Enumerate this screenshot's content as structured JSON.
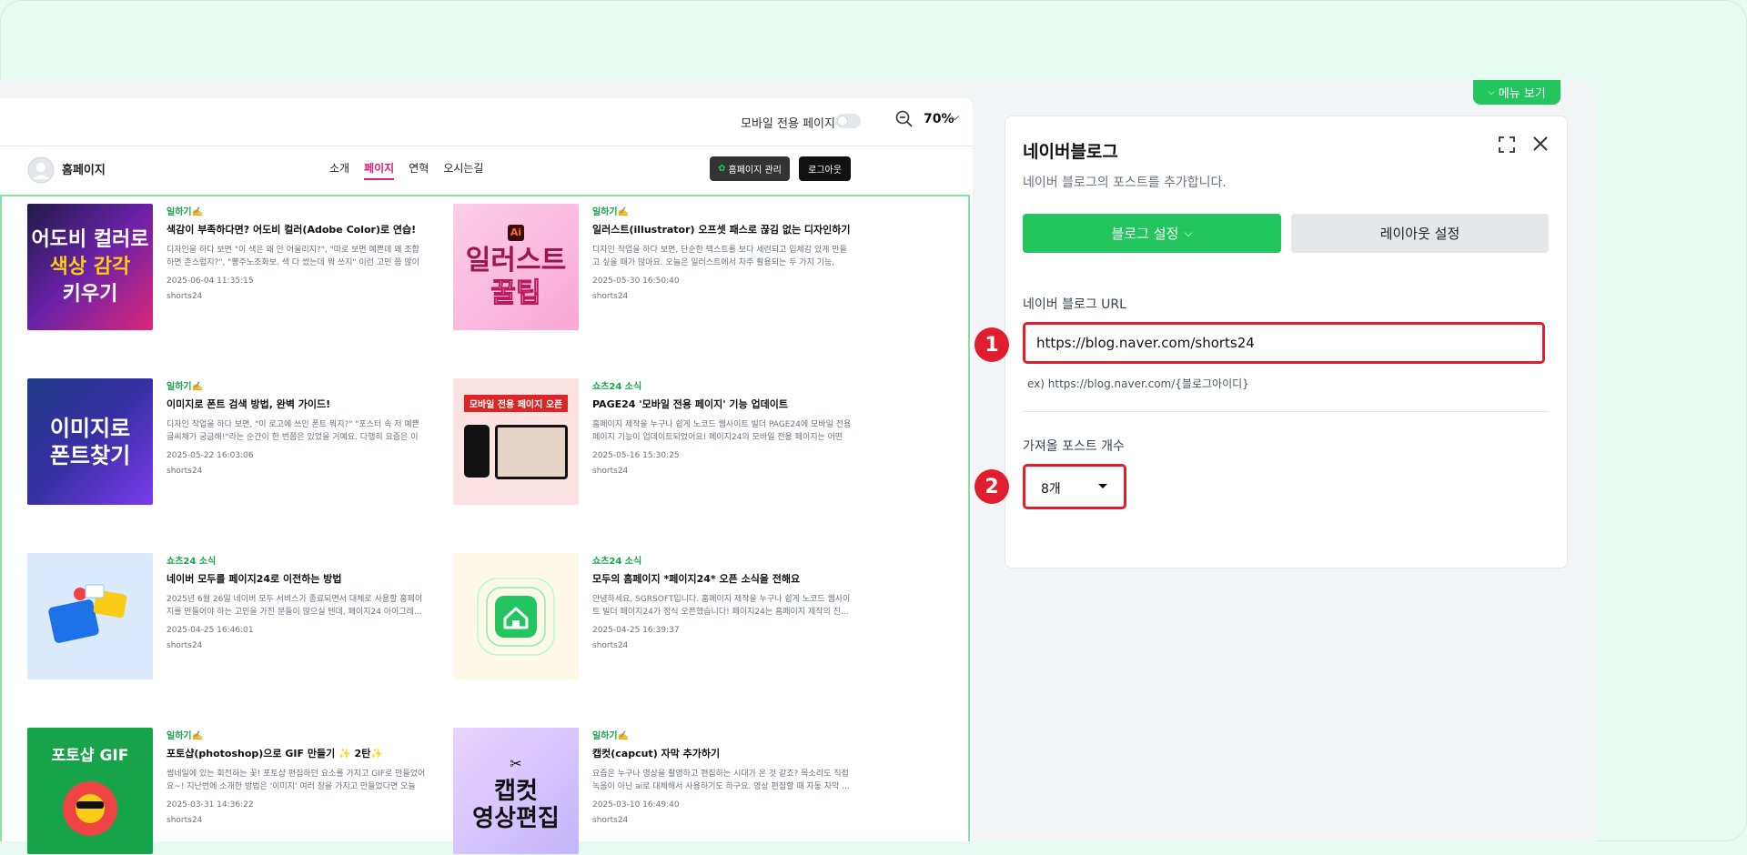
{
  "menu_toggle": {
    "label": "메뉴 보기"
  },
  "preview": {
    "mobile_only_label": "모바일 전용 페이지",
    "zoom": "70%",
    "site": {
      "name": "홈페이지",
      "nav": [
        "소개",
        "페이지",
        "연혁",
        "오시는길"
      ],
      "manage_button": "홈페이지 관리",
      "logout_button": "로그아웃"
    },
    "posts": [
      {
        "category": "일하기✍️",
        "title": "색감이 부족하다면? 어도비 컬러(Adobe Color)로 연습!",
        "desc": "디자인을 하다 보면 \"이 색은 왜 안 어울리지?\", \"따로 보면 예쁜데 왜 조합하면 촌스럽지?\", \"뽕주노조화보. 색 다 썼는데 뭐 쓰지\" 이런 고민 쯤 많이 ...",
        "date": "2025-06-04 11:35:15",
        "author": "shorts24",
        "thumb_text": "어도비 컬러로\n색상 감각\n키우기"
      },
      {
        "category": "일하기✍️",
        "title": "일러스트(illustrator) 오프셋 패스로 끊김 없는 디자인하기",
        "desc": "디자인 작업을 하다 보면, 단순한 텍스트를 보다 세련되고 입체감 있게 만들고 싶을 때가 많아요. 오늘은 일러스트에서 자주 활용되는 두 가지 기능, 오...",
        "date": "2025-05-30 16:50:40",
        "author": "shorts24",
        "thumb_text": "일러스트\n꿀팁"
      },
      {
        "category": "일하기✍️",
        "title": "이미지로 폰트 검색 방법, 완벽 가이드!",
        "desc": "디자인 작업을 하다 보면, \"이 로고에 쓰인 폰트 뭐지?\" \"포스터 속 저 예쁜 글씨체가 궁금해!\"라는 순간이 한 번쯤은 있었을 거예요. 다행히 요즘은 이미...",
        "date": "2025-05-22 16:03:06",
        "author": "shorts24",
        "thumb_text": "이미지로\n폰트찾기"
      },
      {
        "category": "쇼츠24 소식",
        "title": "PAGE24 '모바일 전용 페이지' 기능 업데이트",
        "desc": "홈페이지 제작을 누구나 쉽게 노코드 웹사이트 빌더 PAGE24에 모바일 전용 페이지 기능이 업데이트되었어요! 페이지24의 모바일 전용 페이지는 어떤 ...",
        "date": "2025-05-16 15:30:25",
        "author": "shorts24",
        "thumb_text": "모바일 전용 페이지 오픈"
      },
      {
        "category": "쇼츠24 소식",
        "title": "네이버 모두를 페이지24로 이전하는 방법",
        "desc": "2025년 6월 26일 네이버 모두 서비스가 종료되면서 대체로 사용할 홈페이지를 만들어야 하는 고민을 가진 분들이 많으실 텐데, 페이지24 아이그레...",
        "date": "2025-04-25 16:46:01",
        "author": "shorts24",
        "thumb_text": ""
      },
      {
        "category": "쇼츠24 소식",
        "title": "모두의 홈페이지 *페이지24* 오픈 소식을 전해요",
        "desc": "안녕하세요, SGRSOFT입니다. 홈페이지 제작을 누구나 쉽게 노코드 웹사이트 빌더 페이지24가 정식 오픈했습니다! 페이지24는 홈페이지 제작의 진...",
        "date": "2025-04-25 16:39:37",
        "author": "shorts24",
        "thumb_text": ""
      },
      {
        "category": "일하기✍️",
        "title": "포토샵(photoshop)으로 GIF 만들기 ✨ 2탄✨",
        "desc": "썸네일에 있는 회전하는 꽃! 포토샵 편집하던 요소를 가지고 GIF로 만들었어요~! 지난번에 소개한 방법은 '이미지' 여러 장을 가지고 만들었다면 오늘은...",
        "date": "2025-03-31 14:36:22",
        "author": "shorts24",
        "thumb_text": "포토샵 GIF"
      },
      {
        "category": "일하기✍️",
        "title": "캡컷(capcut) 자막 추가하기",
        "desc": "요즘은 누구나 영상을 촬영하고 편집하는 시대가 온 것 같죠? 목소리도 직접 녹음이 아닌 ai로 대체해서 사용하기도 하구요. 영상 편집할 때 자동 자막 ...",
        "date": "2025-03-10 16:49:40",
        "author": "shorts24",
        "thumb_text": "캡컷\n영상편집"
      }
    ]
  },
  "panel": {
    "title": "네이버블로그",
    "subtitle": "네이버 블로그의 포스트를 추가합니다.",
    "tab_blog": "블로그 설정",
    "tab_layout": "레이아웃 설정",
    "url_label": "네이버 블로그 URL",
    "url_value": "https://blog.naver.com/shorts24",
    "url_example": "ex) https://blog.naver.com/{블로그아이디}",
    "count_label": "가져올 포스트 개수",
    "count_value": "8개"
  },
  "markers": [
    "1",
    "2"
  ],
  "colors": {
    "accent": "#22c55e",
    "highlight": "#e01e2e",
    "nav_active": "#e11d74"
  }
}
